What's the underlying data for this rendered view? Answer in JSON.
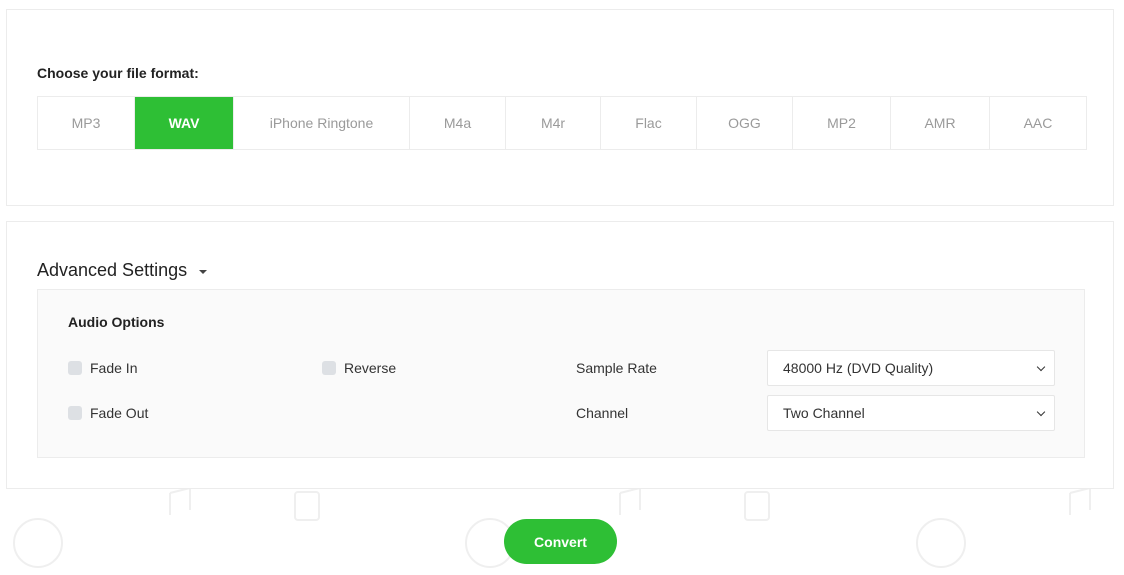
{
  "format_section": {
    "label": "Choose your file format:",
    "formats": [
      {
        "label": "MP3",
        "active": false
      },
      {
        "label": "WAV",
        "active": true
      },
      {
        "label": "iPhone Ringtone",
        "active": false
      },
      {
        "label": "M4a",
        "active": false
      },
      {
        "label": "M4r",
        "active": false
      },
      {
        "label": "Flac",
        "active": false
      },
      {
        "label": "OGG",
        "active": false
      },
      {
        "label": "MP2",
        "active": false
      },
      {
        "label": "AMR",
        "active": false
      },
      {
        "label": "AAC",
        "active": false
      }
    ]
  },
  "advanced": {
    "title": "Advanced Settings",
    "caret_icon": "caret-down-icon",
    "audio_options": {
      "title": "Audio Options",
      "fade_in": {
        "label": "Fade In",
        "checked": false
      },
      "fade_out": {
        "label": "Fade Out",
        "checked": false
      },
      "reverse": {
        "label": "Reverse",
        "checked": false
      },
      "sample_rate": {
        "label": "Sample Rate",
        "value": "48000 Hz (DVD Quality)"
      },
      "channel": {
        "label": "Channel",
        "value": "Two Channel"
      }
    }
  },
  "convert_button": {
    "label": "Convert"
  },
  "colors": {
    "accent": "#2ebf35"
  }
}
